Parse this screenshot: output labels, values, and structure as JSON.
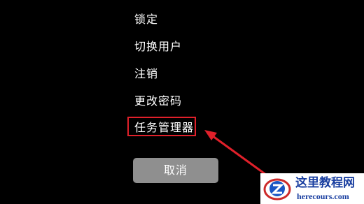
{
  "menu": {
    "items": [
      {
        "label": "锁定"
      },
      {
        "label": "切换用户"
      },
      {
        "label": "注销"
      },
      {
        "label": "更改密码"
      },
      {
        "label": "任务管理器",
        "highlighted": true
      }
    ],
    "cancel_label": "取消"
  },
  "annotation": {
    "highlight_color": "#e0202a",
    "arrow_color": "#e0202a"
  },
  "watermark": {
    "title": "这里教程网",
    "url": "herecours.com"
  },
  "colors": {
    "background": "#000000",
    "text": "#ffffff",
    "cancel_button_bg": "#8f8f8f",
    "watermark_text": "#1a3fa0"
  }
}
